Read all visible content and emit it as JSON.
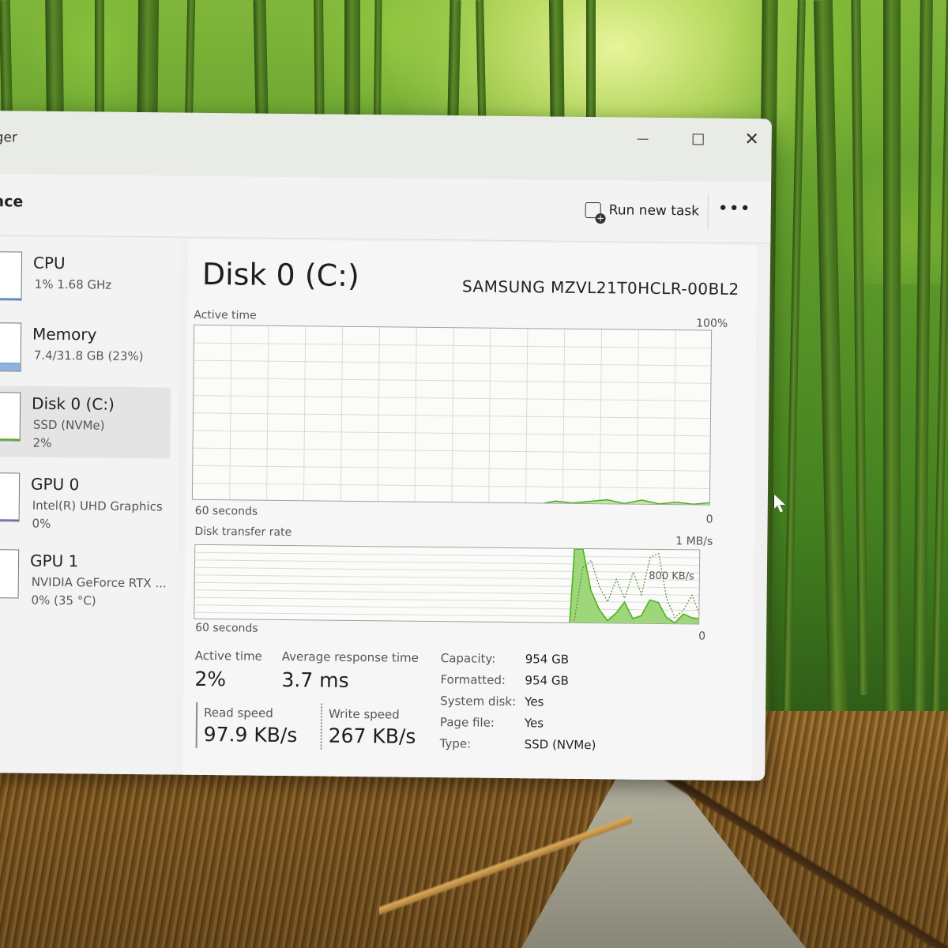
{
  "app": {
    "title": "ger",
    "section": "ance"
  },
  "window_controls": {
    "minimize_icon": "minimize-icon",
    "maximize_icon": "maximize-icon",
    "close_glyph": "✕"
  },
  "toolbar": {
    "run_new_task_label": "Run new task",
    "more_label": "•••"
  },
  "sidebar": {
    "items": [
      {
        "name": "CPU",
        "line1": "1%  1.68 GHz",
        "line2": ""
      },
      {
        "name": "Memory",
        "line1": "7.4/31.8 GB (23%)",
        "line2": ""
      },
      {
        "name": "Disk 0 (C:)",
        "line1": "SSD (NVMe)",
        "line2": "2%",
        "selected": true
      },
      {
        "name": "GPU 0",
        "line1": "Intel(R) UHD Graphics",
        "line2": "0%"
      },
      {
        "name": "GPU 1",
        "line1": "NVIDIA GeForce RTX ...",
        "line2": "0%  (35 °C)"
      }
    ]
  },
  "main": {
    "title": "Disk 0 (C:)",
    "model": "SAMSUNG MZVL21T0HCLR-00BL2",
    "active_chart": {
      "label": "Active time",
      "max_label": "100%",
      "time_label": "60 seconds",
      "min_label": "0"
    },
    "transfer_chart": {
      "label": "Disk transfer rate",
      "max_label": "1 MB/s",
      "mid_label": "800 KB/s",
      "time_label": "60 seconds",
      "min_label": "0"
    },
    "stats": {
      "active_time_label": "Active time",
      "active_time_value": "2%",
      "avg_response_label": "Average response time",
      "avg_response_value": "3.7 ms",
      "read_speed_label": "Read speed",
      "read_speed_value": "97.9 KB/s",
      "write_speed_label": "Write speed",
      "write_speed_value": "267 KB/s"
    },
    "properties": [
      {
        "key": "Capacity:",
        "value": "954 GB"
      },
      {
        "key": "Formatted:",
        "value": "954 GB"
      },
      {
        "key": "System disk:",
        "value": "Yes"
      },
      {
        "key": "Page file:",
        "value": "Yes"
      },
      {
        "key": "Type:",
        "value": "SSD (NVMe)"
      }
    ]
  },
  "colors": {
    "disk_accent": "#4caf1a",
    "disk_fill": "#bfe6a6",
    "grid": "#d8dcd4"
  },
  "chart_data": [
    {
      "type": "area",
      "title": "Active time",
      "ylim": [
        0,
        100
      ],
      "x": [
        40,
        42,
        44,
        46,
        48,
        50,
        52,
        54,
        56,
        58,
        60
      ],
      "values": [
        0,
        2,
        1,
        2,
        3,
        1,
        3,
        1,
        2,
        1,
        2
      ]
    },
    {
      "type": "area",
      "title": "Disk transfer rate",
      "ylim": [
        0,
        1000
      ],
      "series": [
        {
          "x": [
            44.5,
            45,
            46,
            47,
            48,
            49,
            50,
            51,
            52,
            53,
            54,
            55,
            56,
            57,
            58,
            59,
            60
          ],
          "values": [
            0,
            1000,
            1000,
            450,
            200,
            50,
            150,
            300,
            80,
            120,
            330,
            300,
            100,
            30,
            150,
            100,
            80
          ]
        },
        {
          "x": [
            45,
            46,
            47,
            48,
            49,
            50,
            51,
            52,
            53,
            54,
            55,
            56,
            57,
            58,
            59,
            60
          ],
          "values": [
            0,
            750,
            850,
            500,
            300,
            600,
            350,
            700,
            400,
            900,
            950,
            350,
            100,
            200,
            400,
            120
          ]
        }
      ]
    }
  ]
}
